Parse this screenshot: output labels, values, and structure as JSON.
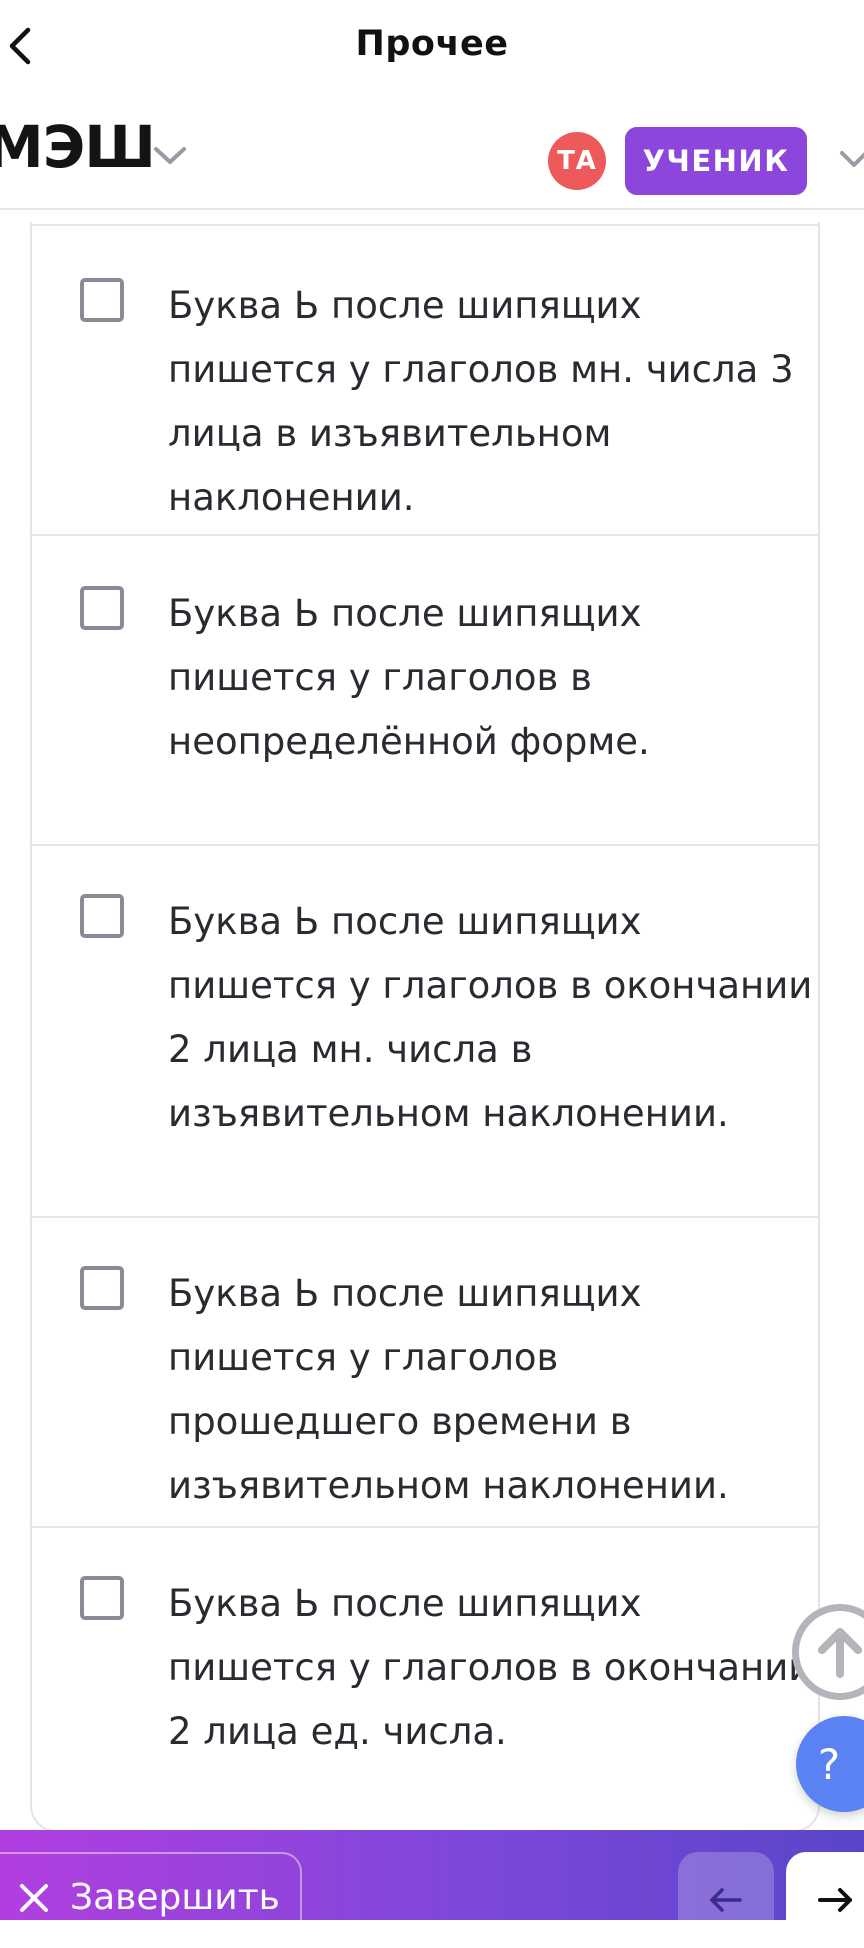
{
  "header": {
    "title": "Прочее",
    "back_icon": "chevron-left-icon"
  },
  "appbar": {
    "logo": "МЭШ",
    "avatar_initials": "ТА",
    "role_label": "УЧЕНИК",
    "colors": {
      "avatar": "#ee5a5c",
      "role_button": "#8c46dc"
    }
  },
  "options": [
    {
      "text": "Буква Ь после шипящих пишется у глаголов мн. числа 3 лица в изъявительном наклонении.",
      "checked": false
    },
    {
      "text": "Буква Ь после шипящих пишется у глаголов в неопределённой форме.",
      "checked": false
    },
    {
      "text": "Буква Ь после шипящих пишется у глаголов в окончании 2 лица мн. числа в изъявительном наклонении.",
      "checked": false
    },
    {
      "text": "Буква Ь после шипящих пишется у глаголов прошедшего времени в изъявительном наклонении.",
      "checked": false
    },
    {
      "text": "Буква Ь после шипящих пишется у глаголов в окончании 2 лица ед. числа.",
      "checked": false
    }
  ],
  "floating": {
    "help_label": "?",
    "help_color": "#5a82f2"
  },
  "footer": {
    "finish_label": "Завершить",
    "gradient": [
      "#b23ee0",
      "#7d48d8",
      "#5a45c8"
    ]
  }
}
